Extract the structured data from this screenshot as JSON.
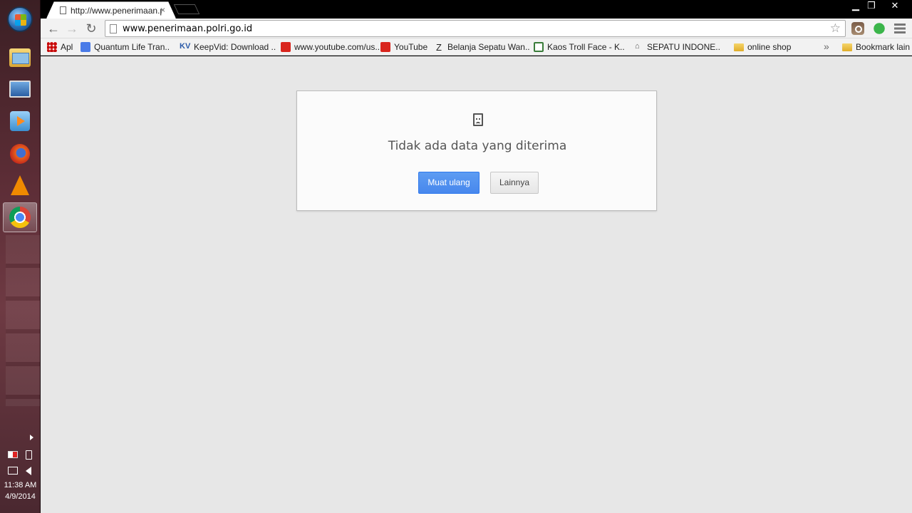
{
  "taskbar": {
    "apps": [
      {
        "name": "start-orb"
      },
      {
        "name": "windows-explorer"
      },
      {
        "name": "remote-desktop"
      },
      {
        "name": "media-player"
      },
      {
        "name": "firefox"
      },
      {
        "name": "vlc"
      },
      {
        "name": "chrome",
        "active": true
      }
    ],
    "clock": {
      "time": "11:38 AM",
      "date": "4/9/2014"
    }
  },
  "browser": {
    "tab": {
      "title": "http://www.penerimaan.p",
      "close": "×"
    },
    "window_controls": {
      "minimize": "▁",
      "maximize": "❐",
      "close": "✕"
    },
    "nav": {
      "back": "←",
      "forward": "→",
      "reload": "↻"
    },
    "omnibox": {
      "url": "www.penerimaan.polri.go.id",
      "star": "☆"
    },
    "bookmarks": [
      {
        "label": "Apl",
        "icon": "apps-grid-icon"
      },
      {
        "label": "Quantum Life Tran..",
        "icon": "google-icon"
      },
      {
        "label": "KeepVid: Download ..",
        "icon": "keepvid-icon",
        "glyph": "KV"
      },
      {
        "label": "www.youtube.com/us..",
        "icon": "youtube-icon"
      },
      {
        "label": "YouTube",
        "icon": "youtube-icon"
      },
      {
        "label": "Belanja Sepatu Wan..",
        "icon": "zalora-icon",
        "glyph": "Z"
      },
      {
        "label": "Kaos Troll Face - K..",
        "icon": "kaos-icon"
      },
      {
        "label": "SEPATU INDONE..",
        "icon": "sepatu-icon"
      },
      {
        "label": "online shop",
        "icon": "folder-icon"
      }
    ],
    "bookmarks_overflow": "»",
    "other_bookmarks": "Bookmark lain"
  },
  "error_page": {
    "message": "Tidak ada data yang diterima",
    "reload_button": "Muat ulang",
    "more_button": "Lainnya"
  },
  "colors": {
    "primary_button": "#4787ed",
    "page_background": "#e7e7e7"
  }
}
